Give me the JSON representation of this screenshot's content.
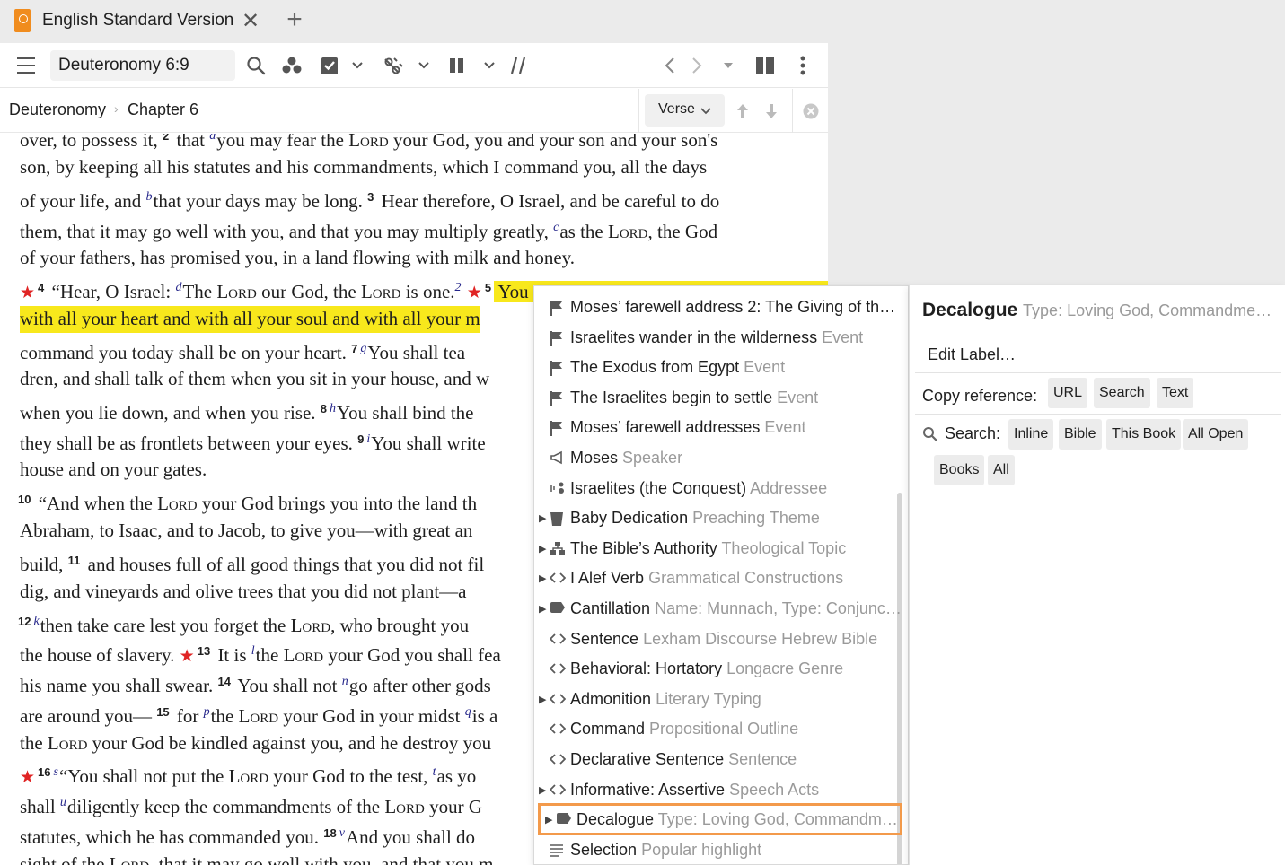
{
  "tab": {
    "title": "English Standard Version",
    "close": "✕",
    "add": "+"
  },
  "toolbar": {
    "reference": "Deuteronomy 6:9"
  },
  "breadcrumb": {
    "book": "Deuteronomy",
    "sep": "›",
    "chapter": "Chapter 6",
    "verse_label": "Verse"
  },
  "text_lines": [
    "over, to possess it, 2 that you may fear the LORD your God, you and your son's",
    "son, by keeping all his statutes and his commandments, which I command you, all the days",
    "of your life, and that your days may be long.",
    "Hear therefore, O Israel, and be careful to do",
    "them, that it may go well with you, and that you may multiply greatly,",
    "as the LORD, the God",
    "of your fathers, has promised you, in a land flowing with milk and honey."
  ],
  "verses": {
    "v3": "3",
    "v4": "4",
    "v5": "5",
    "v7": "7",
    "v8": "8",
    "v9": "9",
    "v10": "10",
    "v11": "11",
    "v12": "12",
    "v13": "13",
    "v14": "14",
    "v15": "15",
    "v16": "16",
    "v18": "18"
  },
  "footnotes": {
    "b": "b",
    "c": "c",
    "d": "d",
    "g": "g",
    "h": "h",
    "i": "i",
    "k": "k",
    "l": "l",
    "n": "n",
    "p": "p",
    "q": "q",
    "s": "s",
    "t": "t",
    "u": "u",
    "v": "v",
    "two": "2"
  },
  "scripture": {
    "l1": "over, to possess it, ",
    "l1b": " that ",
    "l1c": "you may fear the ",
    "lord": "Lord",
    "l1d": " your God, you and your son and your son's",
    "l2": "son, by keeping all his statutes and his commandments, which I command you, all the days",
    "l3a": "of your life, and ",
    "l3b": "that your days may be long. ",
    "l3c": " Hear therefore, O Israel, and be careful to do",
    "l4a": "them, that it may go well with you, and that you may multiply greatly, ",
    "l4b": "as the ",
    "l4c": ", the God",
    "l5": "of your fathers, has promised you, in a land flowing with milk and honey.",
    "l6a": " “Hear, O Israel: ",
    "l6b": "The ",
    "l6c": " our God, the ",
    "l6d": " is one.",
    "l6e": " You",
    "l7": "with all your heart and with all your soul and with all your m",
    "l8a": "command you today shall be on your heart. ",
    "l8b": "You shall tea",
    "l9": "dren, and shall talk of them when you sit in your house, and w",
    "l10a": "when you lie down, and when you rise. ",
    "l10b": "You shall bind the",
    "l11a": "they shall be as frontlets between your eyes. ",
    "l11b": "You shall write",
    "l12": "house and on your gates.",
    "l13a": " “And when the ",
    "l13b": " your God brings you into the land th",
    "l14": "Abraham, to Isaac, and to Jacob, to give you—with great an",
    "l15a": "build, ",
    "l15b": " and houses full of all good things that you did not fil",
    "l16": "dig, and vineyards and olive trees that you did not plant—a",
    "l17a": "then take care lest you forget the ",
    "l17b": ", who brought you",
    "l18a": "the house of slavery. ",
    "l18b": " It is ",
    "l18c": "the ",
    "l18d": " your God you shall fea",
    "l19a": "his name you shall swear. ",
    "l19b": " You shall not ",
    "l19c": "go after other gods",
    "l20a": "are around you— ",
    "l20b": " for ",
    "l20c": "the ",
    "l20d": " your God in your midst ",
    "l20e": "is a",
    "l21a": "the ",
    "l21b": " your God be kindled against you, and he destroy you",
    "l22a": "“You shall not put the ",
    "l22b": " your God to the test, ",
    "l22c": "as yo",
    "l23a": "shall ",
    "l23b": "diligently keep the commandments of the ",
    "l23c": " your G",
    "l24a": "statutes, which he has commanded you. ",
    "l24b": "And you shall do",
    "l25a": "sight of the ",
    "l25b": ", that it may go well with you, and that you m"
  },
  "menu": {
    "items": [
      {
        "label": "Moses’ farewell address 2: The Giving of the…",
        "sub": "",
        "icon": "flag-icon"
      },
      {
        "label": "Israelites wander in the wilderness",
        "sub": "Event",
        "icon": "flag-icon"
      },
      {
        "label": "The Exodus from Egypt",
        "sub": "Event",
        "icon": "flag-icon"
      },
      {
        "label": "The Israelites begin to settle",
        "sub": "Event",
        "icon": "flag-icon"
      },
      {
        "label": "Moses’ farewell addresses",
        "sub": "Event",
        "icon": "flag-icon"
      },
      {
        "label": "Moses",
        "sub": "Speaker",
        "icon": "megaphone-icon"
      },
      {
        "label": "Israelites (the Conquest)",
        "sub": "Addressee",
        "icon": "addressee-icon"
      },
      {
        "label": "Baby Dedication",
        "sub": "Preaching Theme",
        "icon": "theme-icon"
      },
      {
        "label": "The Bible’s Authority",
        "sub": "Theological Topic",
        "icon": "topic-icon"
      },
      {
        "label": "I Alef Verb",
        "sub": "Grammatical Constructions",
        "icon": "code-icon"
      },
      {
        "label": "Cantillation",
        "sub": "Name: Munnach, Type: Conjunc…",
        "icon": "label-icon"
      },
      {
        "label": "Sentence",
        "sub": "Lexham Discourse Hebrew Bible",
        "icon": "code-icon"
      },
      {
        "label": "Behavioral: Hortatory",
        "sub": "Longacre Genre",
        "icon": "code-icon"
      },
      {
        "label": "Admonition",
        "sub": "Literary Typing",
        "icon": "code-icon"
      },
      {
        "label": "Command",
        "sub": "Propositional Outline",
        "icon": "code-icon"
      },
      {
        "label": "Declarative Sentence",
        "sub": "Sentence",
        "icon": "code-icon"
      },
      {
        "label": "Informative: Assertive",
        "sub": "Speech Acts",
        "icon": "code-icon"
      },
      {
        "label": "Decalogue",
        "sub": "Type: Loving God, Commandm…",
        "icon": "label-icon"
      },
      {
        "label": "Selection",
        "sub": "Popular highlight",
        "icon": "lines-icon"
      }
    ]
  },
  "submenu": {
    "title": "Decalogue",
    "title_sub": "Type: Loving God, Commandme…",
    "edit_label": "Edit Label…",
    "copy_reference": "Copy reference:",
    "copy_url": "URL",
    "copy_search": "Search",
    "copy_text": "Text",
    "search_label": "Search:",
    "search_inline": "Inline",
    "search_bible": "Bible",
    "search_this_book": "This Book",
    "search_all_open": "All Open",
    "search_books": "Books",
    "search_all": "All"
  },
  "colors": {
    "accent_orange": "#f39a4b",
    "highlight_yellow": "#f8e81c",
    "star_red": "#e02424",
    "footnote_blue": "#25268a"
  }
}
